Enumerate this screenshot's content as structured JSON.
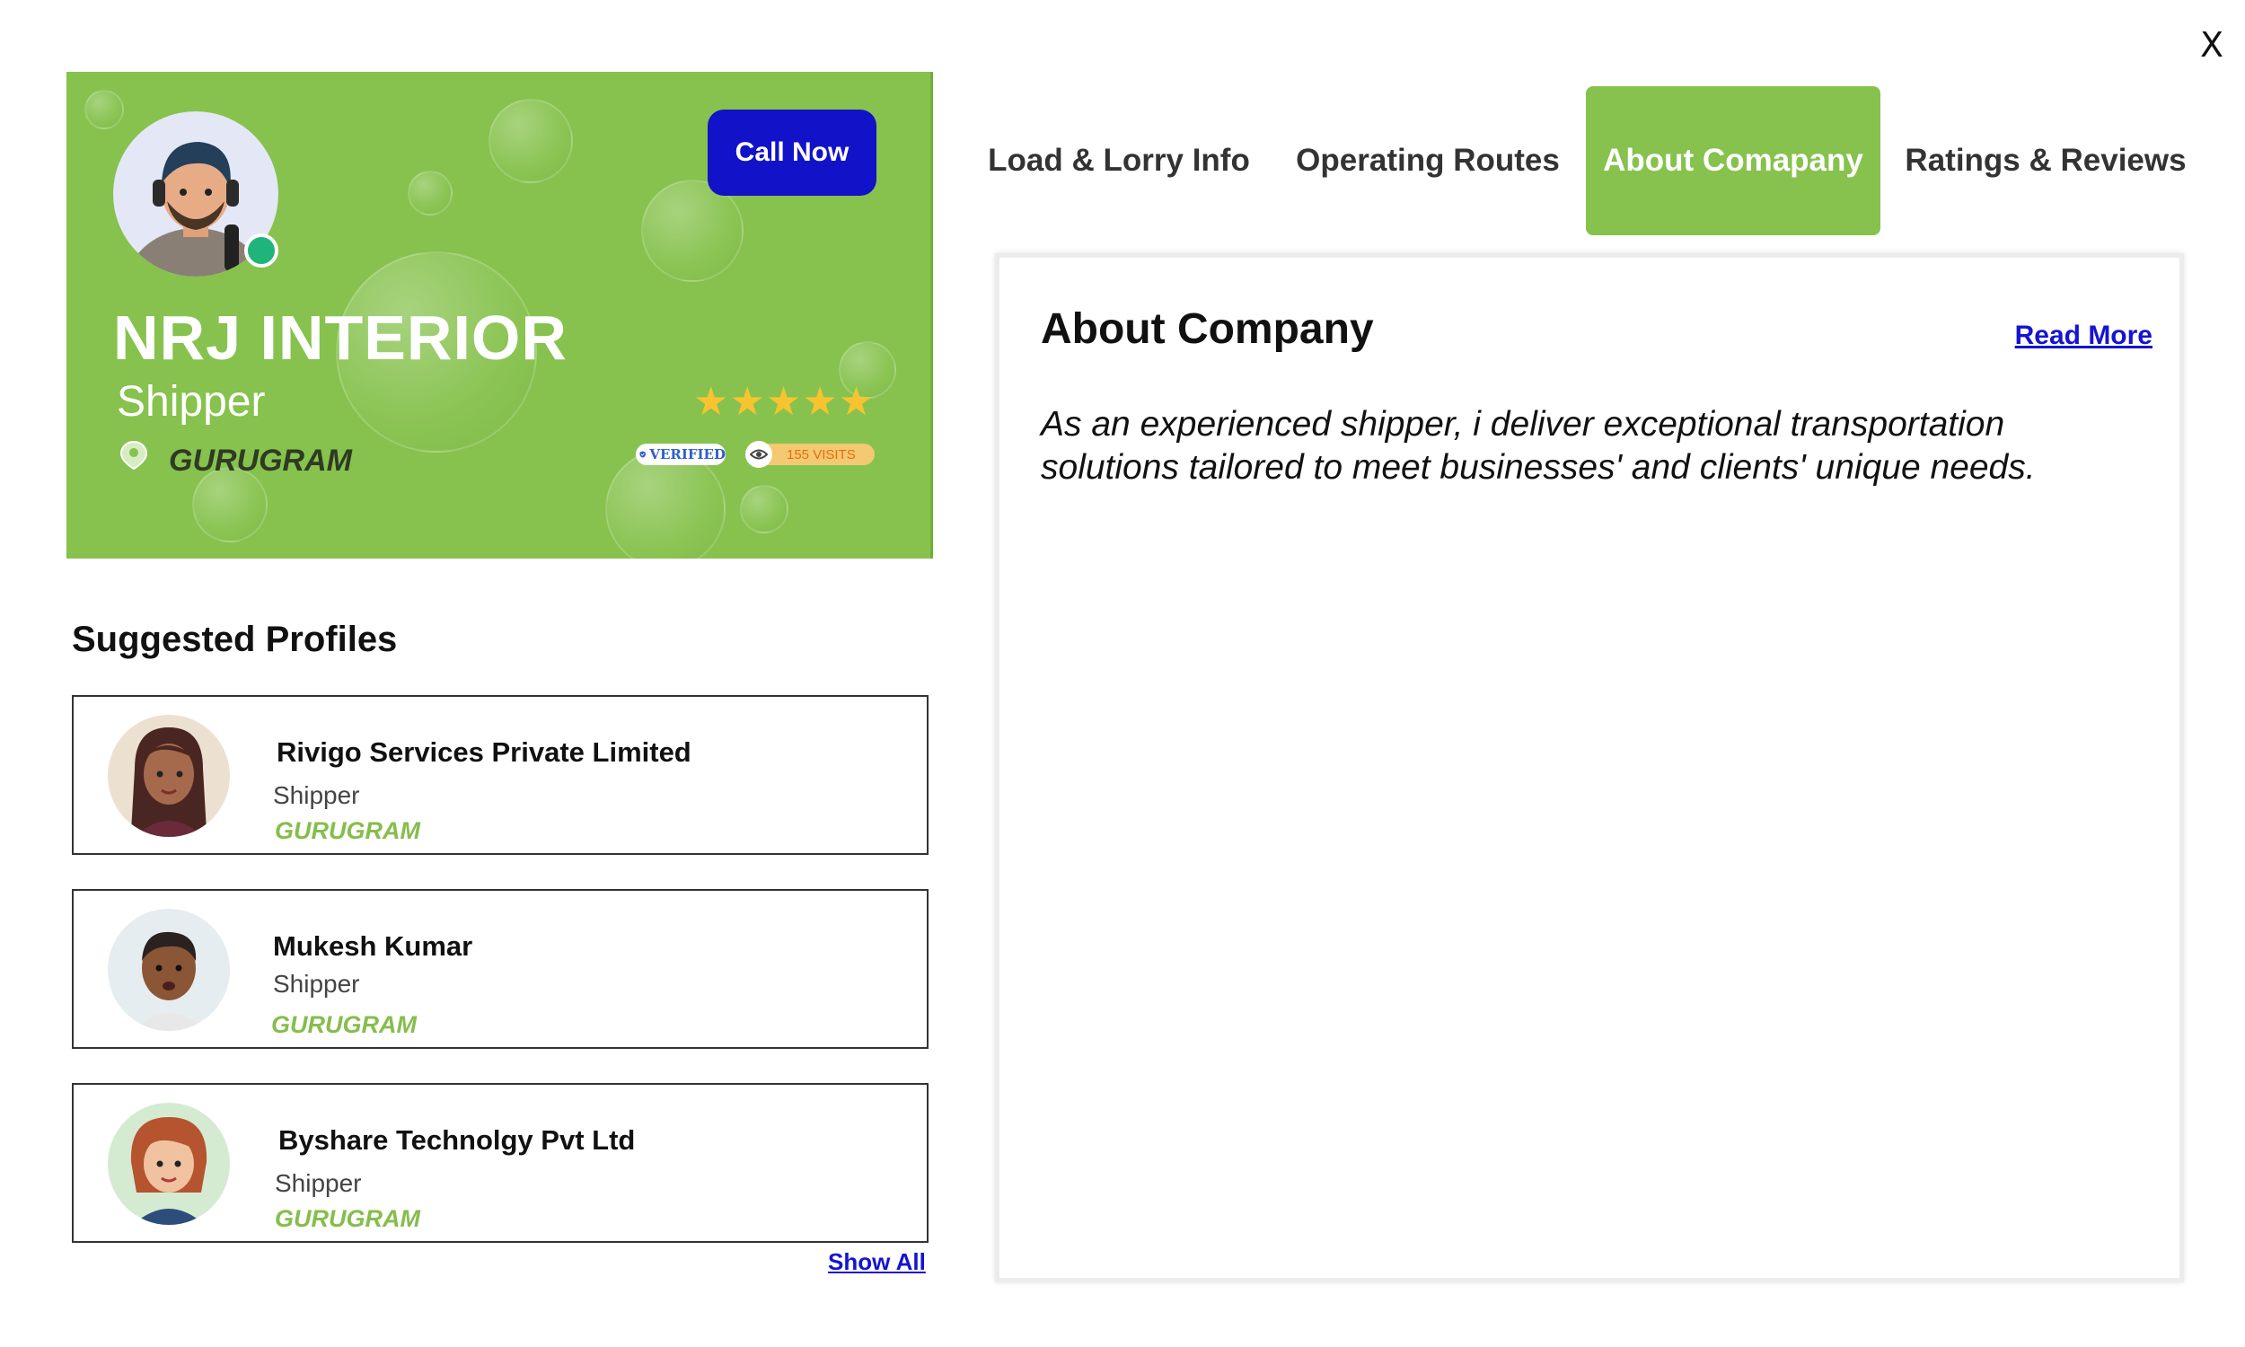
{
  "close_label": "X",
  "profile": {
    "company_name": "NRJ INTERIOR",
    "role": "Shipper",
    "location": "GURUGRAM",
    "call_button": "Call Now",
    "stars": "★★★★★",
    "verified_label": "VERIFIED",
    "visits_label": "155 VISITS",
    "rating_value": 5,
    "rating_max": 5
  },
  "suggested": {
    "title": "Suggested Profiles",
    "items": [
      {
        "name": "Rivigo Services Private Limited",
        "role": "Shipper",
        "location": "GURUGRAM"
      },
      {
        "name": "Mukesh Kumar",
        "role": "Shipper",
        "location": "GURUGRAM"
      },
      {
        "name": "Byshare Technolgy Pvt Ltd",
        "role": "Shipper",
        "location": "GURUGRAM"
      }
    ],
    "show_all": "Show All"
  },
  "tabs": [
    {
      "label": "Load & Lorry Info",
      "active": false
    },
    {
      "label": "Operating Routes",
      "active": false
    },
    {
      "label": "About Comapany",
      "active": true
    },
    {
      "label": "Ratings & Reviews",
      "active": false
    }
  ],
  "about": {
    "title": "About Company",
    "read_more": "Read More",
    "text": "As an experienced shipper, i deliver exceptional transportation solutions tailored to meet businesses' and clients' unique needs."
  },
  "colors": {
    "brand_green": "#86c24d",
    "call_button": "#1212c9",
    "link_blue": "#1414d0",
    "star": "#f7c430",
    "online": "#1fb57a"
  },
  "icons": [
    "close-icon",
    "location-pin-icon",
    "star-icon",
    "verified-shield-icon",
    "eye-icon"
  ]
}
